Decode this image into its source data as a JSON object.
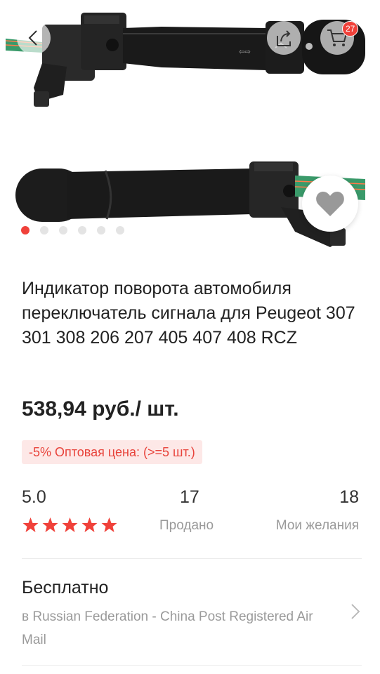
{
  "header": {
    "back_icon": "chevron-left-icon",
    "share_icon": "share-icon",
    "cart_icon": "cart-icon",
    "cart_count": "27"
  },
  "gallery": {
    "image_count": 6,
    "active_index": 0,
    "favorite_icon": "heart-icon"
  },
  "product": {
    "title": "Индикатор поворота автомобиля переключатель сигнала для Peugeot 307 301 308 206 207 405 407 408 RCZ",
    "price": "538,94 руб./ шт.",
    "wholesale": "-5% Оптовая цена: (>=5 шт.)"
  },
  "stats": {
    "rating_value": "5.0",
    "rating_stars": 5,
    "sold_value": "17",
    "sold_label": "Продано",
    "wishlist_value": "18",
    "wishlist_label": "Мои желания"
  },
  "shipping": {
    "title": "Бесплатно",
    "detail": "в Russian Federation - China Post Registered Air Mail"
  },
  "colors": {
    "accent": "#f0413a",
    "muted": "#9a9a9a"
  }
}
